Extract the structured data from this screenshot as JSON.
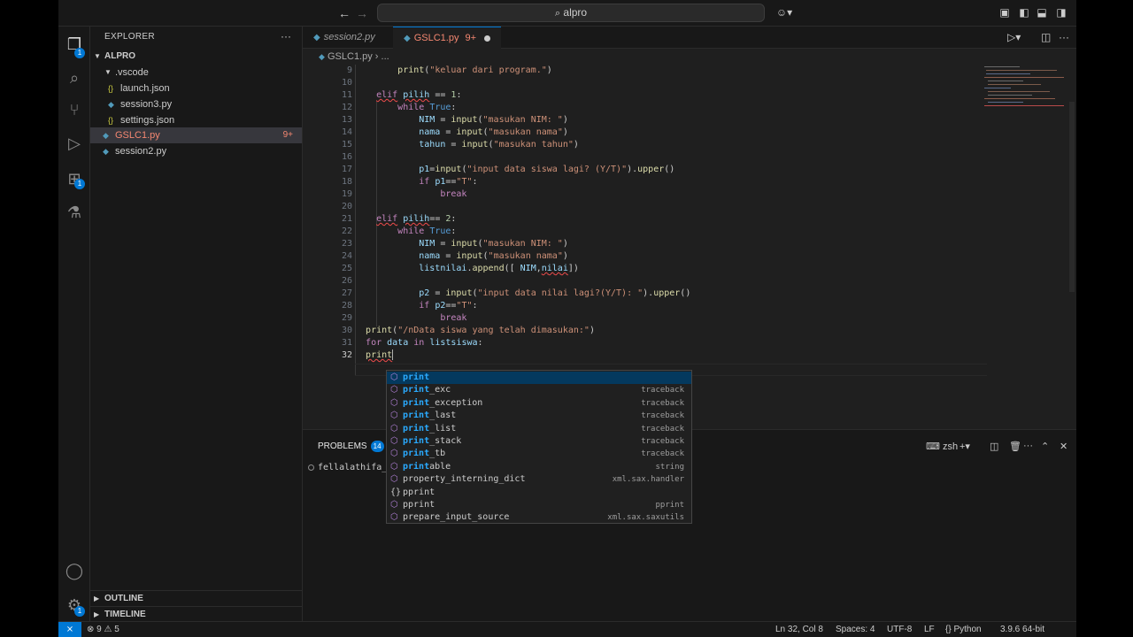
{
  "titlebar": {
    "search_text": "alpro"
  },
  "sidebar": {
    "title": "EXPLORER",
    "more": "···",
    "root": "ALPRO",
    "items": [
      {
        "label": ".vscode",
        "icon": "folder"
      },
      {
        "label": "launch.json",
        "icon": "json"
      },
      {
        "label": "session3.py",
        "icon": "python"
      },
      {
        "label": "settings.json",
        "icon": "json"
      },
      {
        "label": "GSLC1.py",
        "icon": "python",
        "errors": "9+"
      },
      {
        "label": "session2.py",
        "icon": "python"
      }
    ],
    "outline": "OUTLINE",
    "timeline": "TIMELINE"
  },
  "activity_badges": {
    "explorer": "1",
    "extensions": "1",
    "settings": "1"
  },
  "tabs": [
    {
      "label": "session2.py",
      "active": false
    },
    {
      "label": "GSLC1.py",
      "badge": "9+",
      "active": true
    }
  ],
  "breadcrumb": {
    "file": "GSLC1.py",
    "sep": "›",
    "rest": "..."
  },
  "editor": {
    "current_line": 32,
    "line_numbers": [
      "9",
      "10",
      "11",
      "12",
      "13",
      "14",
      "15",
      "16",
      "17",
      "18",
      "19",
      "20",
      "21",
      "22",
      "23",
      "24",
      "25",
      "26",
      "27",
      "28",
      "29",
      "30",
      "31",
      "32"
    ]
  },
  "suggest": [
    {
      "label": "print",
      "match": "print",
      "detail": "",
      "icon": "cube",
      "focused": true
    },
    {
      "label": "print_exc",
      "match": "print",
      "detail": "traceback",
      "icon": "cube"
    },
    {
      "label": "print_exception",
      "match": "print",
      "detail": "traceback",
      "icon": "cube"
    },
    {
      "label": "print_last",
      "match": "print",
      "detail": "traceback",
      "icon": "cube"
    },
    {
      "label": "print_list",
      "match": "print",
      "detail": "traceback",
      "icon": "cube"
    },
    {
      "label": "print_stack",
      "match": "print",
      "detail": "traceback",
      "icon": "cube"
    },
    {
      "label": "print_tb",
      "match": "print",
      "detail": "traceback",
      "icon": "cube"
    },
    {
      "label": "printable",
      "match": "print",
      "detail": "string",
      "icon": "cube"
    },
    {
      "label": "property_interning_dict",
      "match": "",
      "detail": "xml.sax.handler",
      "icon": "cube"
    },
    {
      "label": "pprint",
      "match": "",
      "detail": "",
      "icon": "braces"
    },
    {
      "label": "pprint",
      "match": "",
      "detail": "pprint",
      "icon": "cube"
    },
    {
      "label": "prepare_input_source",
      "match": "",
      "detail": "xml.sax.saxutils",
      "icon": "cube"
    }
  ],
  "panel": {
    "tab": "PROBLEMS",
    "count": "14",
    "shell": "zsh",
    "terminal_text": "fellalathifa_@"
  },
  "status": {
    "errors": "9",
    "warnings": "5",
    "position": "Ln 32, Col 8",
    "spaces": "Spaces: 4",
    "encoding": "UTF-8",
    "eol": "LF",
    "language": "Python",
    "interpreter": "3.9.6 64-bit"
  }
}
